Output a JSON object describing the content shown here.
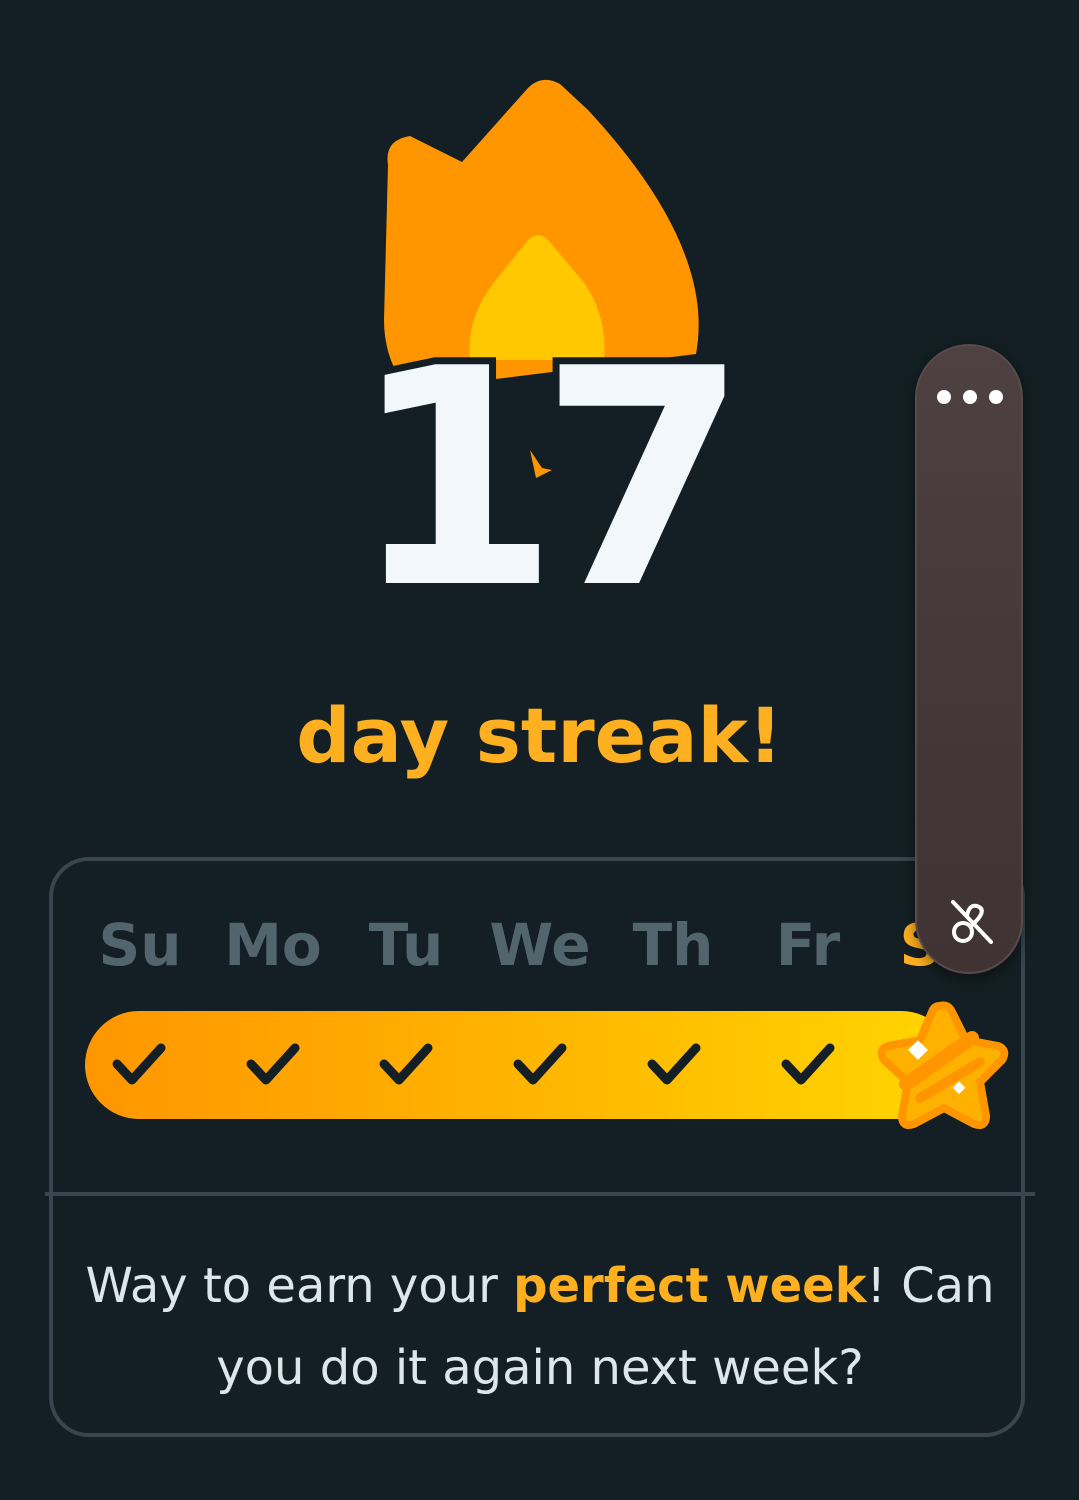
{
  "streak": {
    "count": "17",
    "label": "day streak!"
  },
  "week": {
    "days": [
      "Su",
      "Mo",
      "Tu",
      "We",
      "Th",
      "Fr",
      "Sa"
    ],
    "completed": [
      true,
      true,
      true,
      true,
      true,
      true,
      true
    ]
  },
  "message": {
    "before": "Way to earn your ",
    "highlight": "perfect week",
    "after": "! Can you do it again next week?"
  },
  "colors": {
    "background": "#131f24",
    "accent": "#ffb020",
    "flame_outer": "#ff9600",
    "flame_inner": "#ffc800",
    "day_label": "#52656d",
    "card_border": "#37464f"
  },
  "icons": {
    "flame": "streak-flame-icon",
    "check": "check-icon",
    "star": "perfect-week-star-icon",
    "more": "more-options-icon",
    "unlink": "unlink-icon"
  }
}
